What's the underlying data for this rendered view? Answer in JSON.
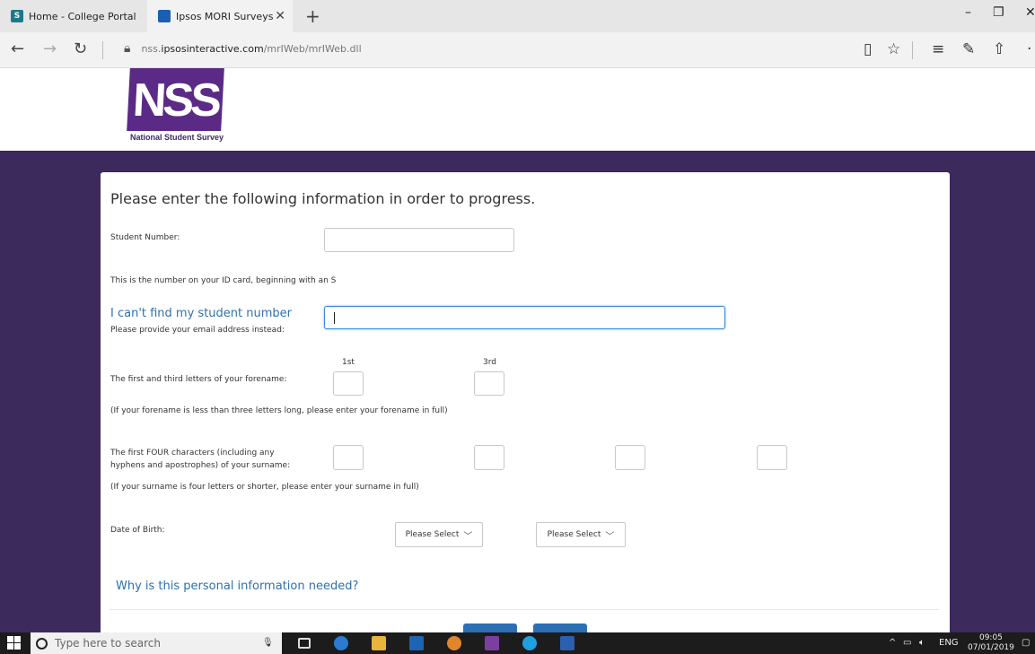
{
  "browser": {
    "tabs": [
      {
        "label": "Home - College Portal",
        "favicon": "sharepoint-icon"
      },
      {
        "label": "Ipsos MORI Surveys",
        "favicon": "ipsos-icon"
      }
    ],
    "address": {
      "prefix": "nss.",
      "domain": "ipsosinteractive.com",
      "path": "/mrIWeb/mrIWeb.dll"
    }
  },
  "logo": {
    "mark": "NSS",
    "text": "National Student Survey",
    "color": "#5b2a86"
  },
  "form": {
    "heading": "Please enter the following information in order to progress.",
    "student_number_label": "Student Number:",
    "student_number_hint": "This is the number on your ID card, beginning with an S",
    "cant_find_link": "I can't find my student number",
    "email_label": "Please provide your email address instead:",
    "forename_label": "The first and third letters of your forename:",
    "forename_col1": "1st",
    "forename_col3": "3rd",
    "forename_hint": "(If your forename is less than three letters long, please enter your forename in full)",
    "surname_label_line1": "The first FOUR characters (including any",
    "surname_label_line2": "hyphens and apostrophes) of your surname:",
    "surname_hint": "(If your surname is four letters or shorter, please enter your surname in full)",
    "dob_label": "Date of Birth:",
    "dob_select1": "Please Select",
    "dob_select2": "Please Select",
    "why_link": "Why is this personal information needed?"
  },
  "taskbar": {
    "search_placeholder": "Type here to search",
    "tray_lang": "ENG",
    "time": "09:05",
    "date": "07/01/2019"
  },
  "colors": {
    "background": "#3d2a5c",
    "link": "#2f6fb0",
    "accent": "#2c6fb3"
  }
}
